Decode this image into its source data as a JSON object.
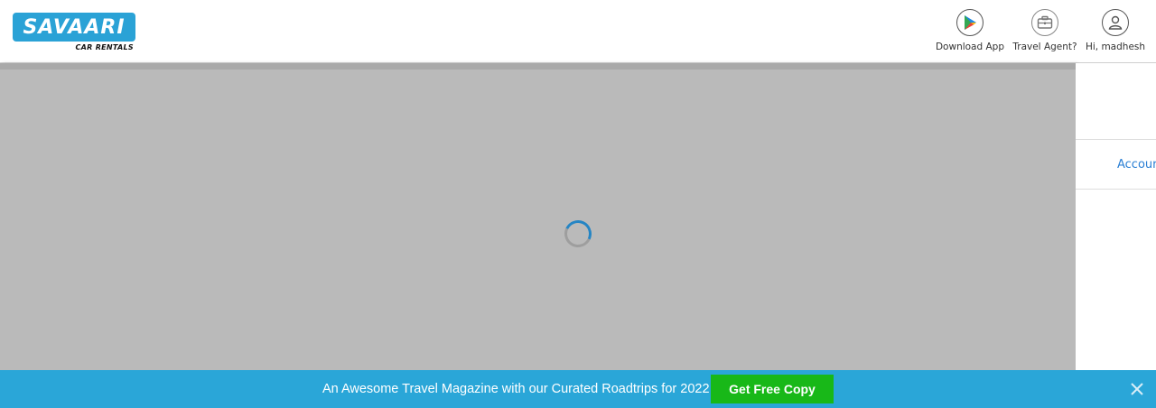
{
  "header": {
    "logo": {
      "brand": "SAVAARI",
      "tagline": "CAR RENTALS"
    },
    "nav": [
      {
        "label": "Download App",
        "icon": "play-store-icon"
      },
      {
        "label": "Travel Agent?",
        "icon": "briefcase-icon"
      },
      {
        "label": "Hi, madhesh",
        "icon": "user-icon"
      }
    ]
  },
  "main": {
    "loading": true,
    "side_panel": {
      "link_text": "Accour"
    }
  },
  "banner": {
    "text": "An Awesome Travel Magazine with our Curated Roadtrips for 2022",
    "button_label": "Get Free Copy",
    "close_icon": "close-icon"
  },
  "colors": {
    "brand": "#2aa2d6",
    "banner_bg": "#2aa6d8",
    "button_green": "#18b818",
    "link_blue": "#2a7fd4",
    "overlay_gray": "#bababa",
    "spinner_accent": "#2585c4"
  }
}
